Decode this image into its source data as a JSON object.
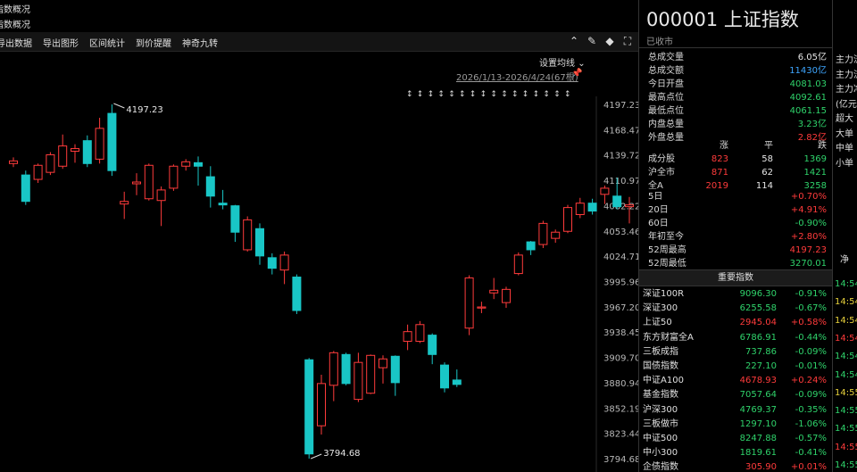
{
  "top": {
    "line1": "指数概况",
    "line2": "指数概况"
  },
  "toolbar": {
    "items": [
      "导出数据",
      "导出图形",
      "区间统计",
      "到价提醒",
      "神奇九转"
    ]
  },
  "chart": {
    "ma_setting": "设置均线",
    "date_range": "2026/1/13-2026/4/24(67根)",
    "high_label": "4197.23",
    "low_label": "3794.68"
  },
  "chart_data": {
    "type": "candlestick",
    "ylim": [
      3794.68,
      4197.23
    ],
    "y_ticks": [
      "4197.23",
      "4168.47",
      "4139.72",
      "4110.97",
      "4082.22",
      "4053.46",
      "4024.71",
      "3995.96",
      "3967.20",
      "3938.45",
      "3909.70",
      "3880.94",
      "3852.19",
      "3823.44",
      "3794.68"
    ],
    "candles": [
      {
        "o": 4130,
        "c": 4133,
        "h": 4137,
        "l": 4126
      },
      {
        "o": 4117,
        "c": 4087,
        "h": 4122,
        "l": 4083
      },
      {
        "o": 4112,
        "c": 4128,
        "h": 4130,
        "l": 4108
      },
      {
        "o": 4120,
        "c": 4140,
        "h": 4143,
        "l": 4117
      },
      {
        "o": 4127,
        "c": 4150,
        "h": 4163,
        "l": 4124
      },
      {
        "o": 4144,
        "c": 4147,
        "h": 4152,
        "l": 4131
      },
      {
        "o": 4156,
        "c": 4130,
        "h": 4162,
        "l": 4126
      },
      {
        "o": 4135,
        "c": 4170,
        "h": 4182,
        "l": 4130
      },
      {
        "o": 4187,
        "c": 4122,
        "h": 4197.23,
        "l": 4116
      },
      {
        "o": 4084,
        "c": 4087,
        "h": 4098,
        "l": 4067
      },
      {
        "o": 4107,
        "c": 4109,
        "h": 4119,
        "l": 4094
      },
      {
        "o": 4090,
        "c": 4128,
        "h": 4130,
        "l": 4088
      },
      {
        "o": 4088,
        "c": 4100,
        "h": 4104,
        "l": 4059
      },
      {
        "o": 4102,
        "c": 4127,
        "h": 4129,
        "l": 4099
      },
      {
        "o": 4127,
        "c": 4132,
        "h": 4135,
        "l": 4122
      },
      {
        "o": 4131,
        "c": 4127,
        "h": 4138,
        "l": 4105
      },
      {
        "o": 4115,
        "c": 4093,
        "h": 4127,
        "l": 4080
      },
      {
        "o": 4085,
        "c": 4083,
        "h": 4100,
        "l": 4078
      },
      {
        "o": 4082,
        "c": 4052,
        "h": 4083,
        "l": 4041
      },
      {
        "o": 4032,
        "c": 4066,
        "h": 4070,
        "l": 4030
      },
      {
        "o": 4056,
        "c": 4025,
        "h": 4062,
        "l": 4015
      },
      {
        "o": 4023,
        "c": 4011,
        "h": 4028,
        "l": 4004
      },
      {
        "o": 4009,
        "c": 4026,
        "h": 4030,
        "l": 3993
      },
      {
        "o": 4001,
        "c": 3963,
        "h": 4004,
        "l": 3959
      },
      {
        "o": 3907,
        "c": 3800,
        "h": 3909,
        "l": 3794.68
      },
      {
        "o": 3832,
        "c": 3880,
        "h": 3890,
        "l": 3822
      },
      {
        "o": 3878,
        "c": 3915,
        "h": 3917,
        "l": 3860
      },
      {
        "o": 3913,
        "c": 3880,
        "h": 3915,
        "l": 3878
      },
      {
        "o": 3862,
        "c": 3904,
        "h": 3915,
        "l": 3859
      },
      {
        "o": 3869,
        "c": 3912,
        "h": 3913,
        "l": 3868
      },
      {
        "o": 3898,
        "c": 3908,
        "h": 3912,
        "l": 3880
      },
      {
        "o": 3911,
        "c": 3881,
        "h": 3912,
        "l": 3866
      },
      {
        "o": 3928,
        "c": 3939,
        "h": 3947,
        "l": 3918
      },
      {
        "o": 3928,
        "c": 3947,
        "h": 3951,
        "l": 3926
      },
      {
        "o": 3935,
        "c": 3913,
        "h": 3937,
        "l": 3902
      },
      {
        "o": 3901,
        "c": 3875,
        "h": 3904,
        "l": 3870
      },
      {
        "o": 3884,
        "c": 3879,
        "h": 3896,
        "l": 3876
      },
      {
        "o": 3943,
        "c": 4000,
        "h": 4003,
        "l": 3935
      },
      {
        "o": 3966,
        "c": 3967,
        "h": 3973,
        "l": 3960
      },
      {
        "o": 3983,
        "c": 3986,
        "h": 4000,
        "l": 3976
      },
      {
        "o": 3972,
        "c": 3987,
        "h": 3990,
        "l": 3966
      },
      {
        "o": 4005,
        "c": 4026,
        "h": 4029,
        "l": 4003
      },
      {
        "o": 4041,
        "c": 4032,
        "h": 4042,
        "l": 4026
      },
      {
        "o": 4038,
        "c": 4062,
        "h": 4065,
        "l": 4034
      },
      {
        "o": 4045,
        "c": 4052,
        "h": 4055,
        "l": 4040
      },
      {
        "o": 4053,
        "c": 4080,
        "h": 4083,
        "l": 4051
      },
      {
        "o": 4072,
        "c": 4085,
        "h": 4091,
        "l": 4068
      },
      {
        "o": 4085,
        "c": 4076,
        "h": 4090,
        "l": 4072
      },
      {
        "o": 4095,
        "c": 4102,
        "h": 4105,
        "l": 4084
      },
      {
        "o": 4093,
        "c": 4081,
        "h": 4114,
        "l": 4078
      },
      {
        "o": 4081,
        "c": 4083,
        "h": 4092,
        "l": 4062
      }
    ]
  },
  "panel": {
    "title": "000001 上证指数",
    "status": "已收市",
    "stats": [
      {
        "k": "总成交量",
        "v": "6.05亿",
        "color": "white"
      },
      {
        "k": "总成交额",
        "v": "11430亿",
        "color": "blue"
      },
      {
        "k": "今日开盘",
        "v": "4081.03",
        "color": "green"
      },
      {
        "k": "最高点位",
        "v": "4092.61",
        "color": "green"
      },
      {
        "k": "最低点位",
        "v": "4061.15",
        "color": "green"
      },
      {
        "k": "内盘总量",
        "v": "3.23亿",
        "color": "green"
      },
      {
        "k": "外盘总量",
        "v": "2.82亿",
        "color": "red"
      }
    ],
    "breadth_header": [
      "涨",
      "平",
      "跌"
    ],
    "breadth": [
      {
        "k": "成分股",
        "a": "823",
        "b": "58",
        "c": "1369"
      },
      {
        "k": "沪全市",
        "a": "871",
        "b": "62",
        "c": "1421"
      },
      {
        "k": "全A",
        "a": "2019",
        "b": "114",
        "c": "3258"
      }
    ],
    "periods": [
      {
        "k": "5日",
        "v": "+0.70%",
        "color": "red"
      },
      {
        "k": "20日",
        "v": "+4.91%",
        "color": "red"
      },
      {
        "k": "60日",
        "v": "-0.90%",
        "color": "green"
      },
      {
        "k": "年初至今",
        "v": "+2.80%",
        "color": "red"
      },
      {
        "k": "52周最高",
        "v": "4197.23",
        "color": "red"
      },
      {
        "k": "52周最低",
        "v": "3270.01",
        "color": "green"
      }
    ],
    "indices_title": "重要指数",
    "indices": [
      {
        "n": "深证100R",
        "p": "9096.30",
        "c": "-0.91%",
        "color": "green"
      },
      {
        "n": "深证300",
        "p": "6255.58",
        "c": "-0.67%",
        "color": "green"
      },
      {
        "n": "上证50",
        "p": "2945.04",
        "c": "+0.58%",
        "color": "red"
      },
      {
        "n": "东方财富全A",
        "p": "6786.91",
        "c": "-0.44%",
        "color": "green"
      },
      {
        "n": "三板成指",
        "p": "737.86",
        "c": "-0.09%",
        "color": "green"
      },
      {
        "n": "国债指数",
        "p": "227.10",
        "c": "-0.01%",
        "color": "green"
      },
      {
        "n": "中证A100",
        "p": "4678.93",
        "c": "+0.24%",
        "color": "red"
      },
      {
        "n": "基金指数",
        "p": "7057.64",
        "c": "-0.09%",
        "color": "green"
      },
      {
        "n": "沪深300",
        "p": "4769.37",
        "c": "-0.35%",
        "color": "green"
      },
      {
        "n": "三板做市",
        "p": "1297.10",
        "c": "-1.06%",
        "color": "green"
      },
      {
        "n": "中证500",
        "p": "8247.88",
        "c": "-0.57%",
        "color": "green"
      },
      {
        "n": "中小300",
        "p": "1819.61",
        "c": "-0.41%",
        "color": "green"
      },
      {
        "n": "企债指数",
        "p": "305.90",
        "c": "+0.01%",
        "color": "red"
      }
    ]
  },
  "fund_flow": {
    "labels": [
      "主力流",
      "主力流",
      "主力净",
      "(亿元",
      "超大",
      "大单",
      "中单",
      "小单"
    ],
    "net_label": "净",
    "times": [
      {
        "t": "14:54",
        "color": "green"
      },
      {
        "t": "14:54",
        "color": "yellow"
      },
      {
        "t": "14:54",
        "color": "yellow"
      },
      {
        "t": "14:54",
        "color": "red"
      },
      {
        "t": "14:54",
        "color": "green"
      },
      {
        "t": "14:54",
        "color": "green"
      },
      {
        "t": "14:55",
        "color": "yellow"
      },
      {
        "t": "14:55",
        "color": "green"
      },
      {
        "t": "14:55",
        "color": "green"
      },
      {
        "t": "14:55",
        "color": "red"
      },
      {
        "t": "14:55",
        "color": "green"
      }
    ]
  }
}
